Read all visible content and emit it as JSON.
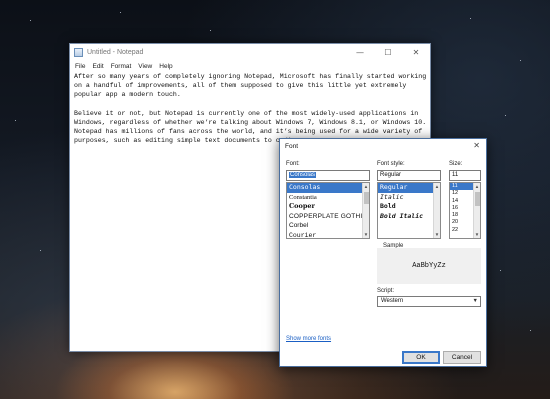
{
  "notepad": {
    "title": "Untitled - Notepad",
    "minimize": "—",
    "maximize": "☐",
    "close": "✕",
    "menu": [
      "File",
      "Edit",
      "Format",
      "View",
      "Help"
    ],
    "text": "After so many years of completely ignoring Notepad, Microsoft has finally started working\non a handful of improvements, all of them supposed to give this little yet extremely\npopular app a modern touch.\n\nBelieve it or not, but Notepad is currently one of the most widely-used applications in\nWindows, regardless of whether we’re talking about Windows 7, Windows 8.1, or Windows 10.\nNotepad has millions of fans across the world, and it’s being used for a wide variety of\npurposes, such as editing simple text documents to coding."
  },
  "font_dialog": {
    "title": "Font",
    "close": "✕",
    "font_label": "Font:",
    "font_value": "Consolas",
    "fonts": [
      "Consolas",
      "Constantia",
      "Cooper",
      "COPPERPLATE GOTHIC",
      "Corbel",
      "Courier"
    ],
    "selected_font_index": 0,
    "style_label": "Font style:",
    "style_value": "Regular",
    "styles": [
      "Regular",
      "Italic",
      "Bold",
      "Bold Italic"
    ],
    "selected_style_index": 0,
    "size_label": "Size:",
    "size_value": "11",
    "sizes": [
      "11",
      "12",
      "14",
      "16",
      "18",
      "20",
      "22"
    ],
    "selected_size_index": 0,
    "sample_label": "Sample",
    "sample_text": "AaBbYyZz",
    "script_label": "Script:",
    "script_value": "Western",
    "more_fonts_link": "Show more fonts",
    "ok_label": "OK",
    "cancel_label": "Cancel"
  }
}
